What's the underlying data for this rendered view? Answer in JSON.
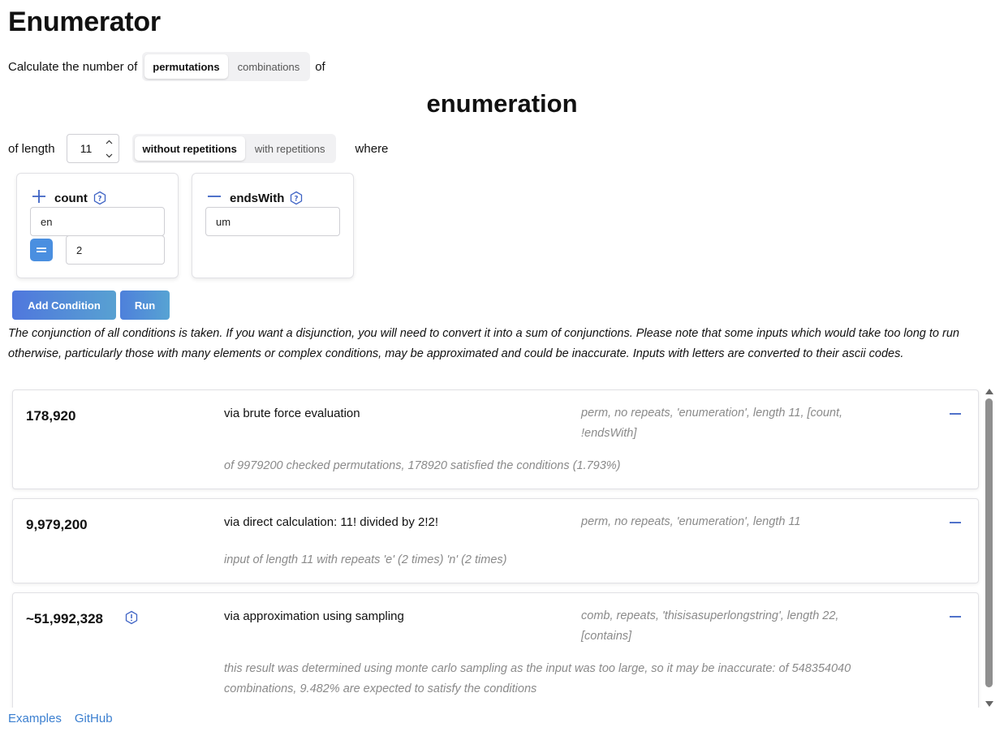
{
  "app": {
    "title": "Enumerator"
  },
  "intro": {
    "prefix": "Calculate the number of",
    "modes": [
      "permutations",
      "combinations"
    ],
    "suffix": "of"
  },
  "input_word": "enumeration",
  "length_row": {
    "label": "of length",
    "value": "11",
    "repetition_options": [
      "without repetitions",
      "with repetitions"
    ],
    "where_label": "where"
  },
  "conditions": [
    {
      "sign": "+",
      "name": "count",
      "text_value": "en",
      "operator_icon": "equals-icon",
      "number_value": "2"
    },
    {
      "sign": "—",
      "name": "endsWith",
      "text_value": "um"
    }
  ],
  "buttons": {
    "add_condition": "Add Condition",
    "run": "Run"
  },
  "notice": "The conjunction of all conditions is taken. If you want a disjunction, you will need to convert it into a sum of conjunctions. Please note that some inputs which would take too long to run otherwise, particularly those with many elements or complex conditions, may be approximated and could be inaccurate. Inputs with letters are converted to their ascii codes.",
  "results": [
    {
      "count": "178,920",
      "method": "via brute force evaluation",
      "meta": "perm, no repeats, 'enumeration', length 11, [count, !endsWith]",
      "detail": "of 9979200 checked permutations, 178920 satisfied the conditions (1.793%)"
    },
    {
      "count": "9,979,200",
      "method": "via direct calculation: 11! divided by 2!2!",
      "meta": "perm, no repeats, 'enumeration', length 11",
      "detail": "input of length 11 with repeats 'e' (2 times) 'n' (2 times)"
    },
    {
      "count": "~51,992,328",
      "method": "via approximation using sampling",
      "meta": "comb, repeats, 'thisisasuperlongstring', length 22, [contains]",
      "detail": "this result was determined using monte carlo sampling as the input was too large, so it may be inaccurate: of 548354040 combinations, 9.482% are expected to satisfy the conditions",
      "warning_icon": "alert-icon"
    }
  ],
  "footer": {
    "links": [
      "Examples",
      "GitHub"
    ]
  },
  "colors": {
    "accent": "#3d62c4",
    "link": "#3b7fd0",
    "muted": "#8a8a8a",
    "equals_button": "#4a8fe0"
  }
}
